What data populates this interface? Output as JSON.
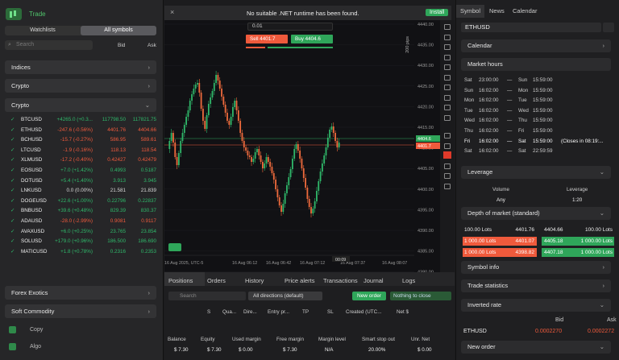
{
  "app": {
    "title": "Trade",
    "tabs": [
      "Watchlists",
      "All symbols"
    ],
    "search_placeholder": "Search",
    "bid": "Bid",
    "ask": "Ask"
  },
  "groups": {
    "indices": "Indices",
    "crypto": "Crypto",
    "crypto_sub": "Crypto",
    "forex": "Forex Exotics",
    "soft": "Soft Commodity"
  },
  "symbols": [
    {
      "s": "BTCUSD",
      "c": "+4265.0 (+0.3...",
      "b": "117798.50",
      "a": "117821.75",
      "d": "up"
    },
    {
      "s": "ETHUSD",
      "c": "-247.6 (-0.56%)",
      "b": "4401.76",
      "a": "4404.66",
      "d": "dn"
    },
    {
      "s": "BCHUSD",
      "c": "-15.7 (-0.27%)",
      "b": "586.95",
      "a": "589.61",
      "d": "dn"
    },
    {
      "s": "LTCUSD",
      "c": "-1.9 (-0.16%)",
      "b": "118.13",
      "a": "118.54",
      "d": "dn"
    },
    {
      "s": "XLMUSD",
      "c": "-17.2 (-0.40%)",
      "b": "0.42427",
      "a": "0.42479",
      "d": "dn"
    },
    {
      "s": "EOSUSD",
      "c": "+7.0 (+1.42%)",
      "b": "0.4993",
      "a": "0.5187",
      "d": "up"
    },
    {
      "s": "DOTUSD",
      "c": "+5.4 (+1.40%)",
      "b": "3.913",
      "a": "3.945",
      "d": "up"
    },
    {
      "s": "LNKUSD",
      "c": "0.0 (0.00%)",
      "b": "21.581",
      "a": "21.839",
      "d": "nu"
    },
    {
      "s": "DOGEUSD",
      "c": "+22.6 (+1.00%)",
      "b": "0.22796",
      "a": "0.22837",
      "d": "up"
    },
    {
      "s": "BNBUSD",
      "c": "+39.6 (+0.48%)",
      "b": "829.39",
      "a": "830.37",
      "d": "up"
    },
    {
      "s": "ADAUSD",
      "c": "-28.0 (-2.99%)",
      "b": "0.9081",
      "a": "0.9117",
      "d": "dn"
    },
    {
      "s": "AVAXUSD",
      "c": "+6.0 (+0.25%)",
      "b": "23.765",
      "a": "23.854",
      "d": "up"
    },
    {
      "s": "SOLUSD",
      "c": "+179.0 (+0.96%)",
      "b": "186.500",
      "a": "186.690",
      "d": "up"
    },
    {
      "s": "MATICUSD",
      "c": "+1.8 (+0.78%)",
      "b": "0.2316",
      "a": "0.2353",
      "d": "up"
    }
  ],
  "leftfoot": {
    "copy": "Copy",
    "algo": "Algo"
  },
  "banner": {
    "msg": "No suitable .NET runtime has been found.",
    "install": "Install"
  },
  "order": {
    "qty": "0.01",
    "sell": "Sell 4401.7",
    "buy": "Buy 4404.6"
  },
  "chart_data": {
    "type": "candlestick",
    "yticks": [
      "4440.00",
      "4435.00",
      "4430.00",
      "4425.00",
      "4420.00",
      "4415.00",
      "4410.00",
      "4405.00",
      "4400.00",
      "4395.00",
      "4390.00",
      "4385.00",
      "4380.00",
      "4375.00",
      "4370.00"
    ],
    "xticks": [
      "16 Aug 2025, UTC-5",
      "16 Aug 06:12",
      "16 Aug 06:42",
      "16 Aug 07:12",
      "16 Aug 07:37",
      "16 Aug 08:07"
    ],
    "buy_price": "4404.6",
    "sell_price": "4401.7",
    "time_label": "00:09",
    "pips_label": "200 pips"
  },
  "bottom": {
    "tabs": [
      "Positions",
      "Orders",
      "History",
      "Price alerts",
      "Transactions",
      "Journal",
      "Logs"
    ],
    "search": "Search",
    "filter": "All directions (default)",
    "new_order": "New order",
    "close": "Nothing to close",
    "cols": [
      "S",
      "Qua...",
      "Dire...",
      "Entry pr...",
      "TP",
      "SL",
      "Created (UTC...",
      "Net $"
    ],
    "stats": [
      {
        "l": "Balance",
        "v": "$ 7.30"
      },
      {
        "l": "Equity",
        "v": "$ 7.30"
      },
      {
        "l": "Used margin",
        "v": "$ 0.00"
      },
      {
        "l": "Free margin",
        "v": "$ 7.30"
      },
      {
        "l": "Margin level",
        "v": "N/A"
      },
      {
        "l": "Smart stop out",
        "v": "20.00%"
      },
      {
        "l": "Unr. Net",
        "v": "$ 0.00"
      }
    ]
  },
  "right": {
    "tabs": [
      "Symbol",
      "News",
      "Calendar"
    ],
    "symbol": "ETHUSD",
    "calendar": "Calendar",
    "market_hours": "Market hours",
    "hours": [
      [
        "Sat",
        "23:00:00",
        "—",
        "Sun",
        "15:59:00",
        ""
      ],
      [
        "Sun",
        "16:02:00",
        "—",
        "Mon",
        "15:59:00",
        ""
      ],
      [
        "Mon",
        "16:02:00",
        "—",
        "Tue",
        "15:59:00",
        ""
      ],
      [
        "Tue",
        "16:02:00",
        "—",
        "Wed",
        "15:59:00",
        ""
      ],
      [
        "Wed",
        "16:02:00",
        "—",
        "Thu",
        "15:59:00",
        ""
      ],
      [
        "Thu",
        "16:02:00",
        "—",
        "Fri",
        "15:59:00",
        ""
      ],
      [
        "Fri",
        "16:02:00",
        "—",
        "Sat",
        "15:59:00",
        "(Closes in 08:19:..."
      ],
      [
        "Sat",
        "16:02:00",
        "—",
        "Sat",
        "22:59:59",
        ""
      ]
    ],
    "leverage": "Leverage",
    "lev_cols": [
      "Volume",
      "Leverage"
    ],
    "lev_vals": [
      "Any",
      "1:20"
    ],
    "dom_title": "Depth of market (standard)",
    "dom": [
      [
        "100.00 Lots",
        "4401.76",
        "4404.66",
        "100.00 Lots"
      ],
      [
        "1 000.00 Lots",
        "4401.07",
        "4405.18",
        "1 000.00 Lots"
      ],
      [
        "1 000.00 Lots",
        "4398.82",
        "4407.18",
        "1 000.00 Lots"
      ]
    ],
    "symbol_info": "Symbol info",
    "trade_stats": "Trade statistics",
    "inverted": "Inverted rate",
    "inv_bid": "Bid",
    "inv_ask": "Ask",
    "inv_sym": "ETHUSD",
    "inv_b": "0.0002270",
    "inv_a": "0.0002272",
    "new_order": "New order"
  }
}
